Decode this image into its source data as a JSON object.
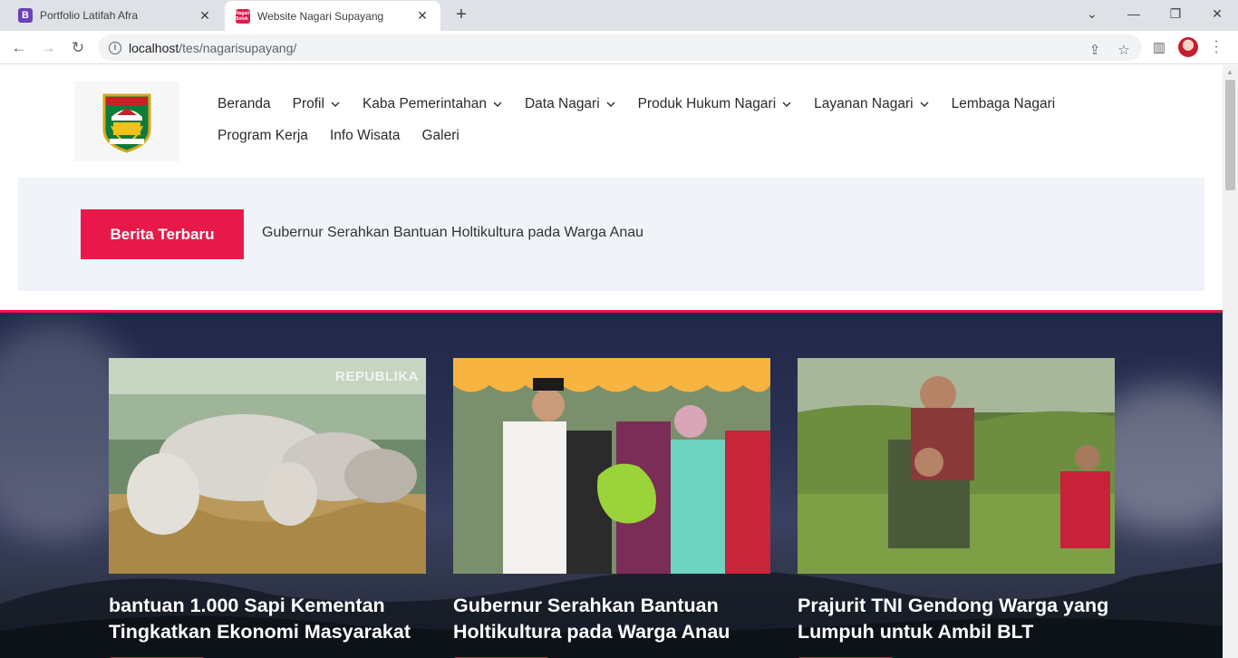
{
  "browser": {
    "tabs": [
      {
        "title": "Portfolio Latifah Afra",
        "favicon": "B",
        "active": false
      },
      {
        "title": "Website Nagari Supayang",
        "favicon": "Nagari Solok",
        "active": true
      }
    ],
    "url_host": "localhost",
    "url_path": "/tes/nagarisupayang/"
  },
  "site": {
    "logo_text": "KABUPATEN SOLOK",
    "nav_row1": [
      {
        "label": "Beranda",
        "dropdown": false
      },
      {
        "label": "Profil",
        "dropdown": true
      },
      {
        "label": "Kaba Pemerintahan",
        "dropdown": true
      },
      {
        "label": "Data Nagari",
        "dropdown": true
      },
      {
        "label": "Produk Hukum Nagari",
        "dropdown": true
      },
      {
        "label": "Layanan Nagari",
        "dropdown": true
      },
      {
        "label": "Lembaga Nagari",
        "dropdown": false
      }
    ],
    "nav_row2": [
      {
        "label": "Program Kerja",
        "dropdown": false
      },
      {
        "label": "Info Wisata",
        "dropdown": false
      },
      {
        "label": "Galeri",
        "dropdown": false
      }
    ]
  },
  "ticker": {
    "badge": "Berita Terbaru",
    "headline": "Gubernur Serahkan Bantuan Holtikultura pada Warga Anau"
  },
  "cards": [
    {
      "title": "bantuan 1.000 Sapi Kementan Tingkatkan Ekonomi Masyarakat",
      "watermark": "REPUBLIKA"
    },
    {
      "title": "Gubernur Serahkan Bantuan Holtikultura pada Warga Anau"
    },
    {
      "title": "Prajurit TNI Gendong Warga yang Lumpuh untuk Ambil BLT"
    }
  ],
  "colors": {
    "accent": "#e8194a",
    "ticker_bg": "#f0f3f8",
    "hero_bg": "#20284a"
  }
}
